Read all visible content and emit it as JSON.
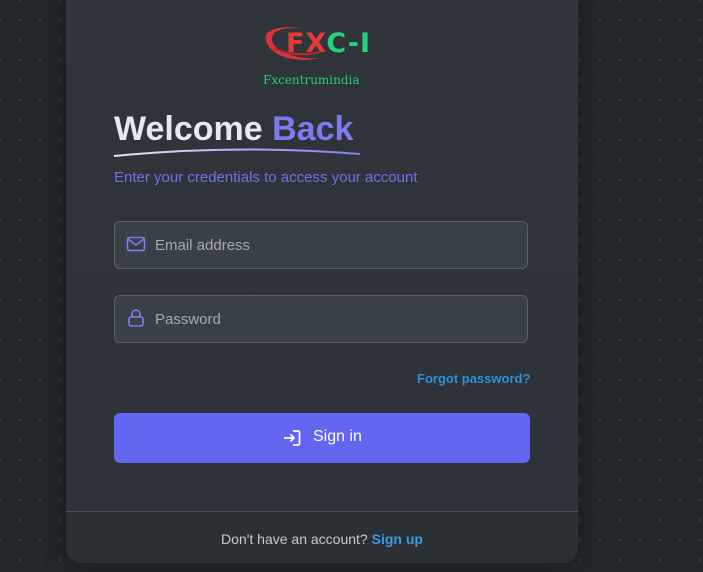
{
  "logo": {
    "mark_text_fx": "FX",
    "mark_text_rest": "C-I",
    "subtitle": "Fxcentrumindia"
  },
  "heading": {
    "part1": "Welcome ",
    "part2": "Back"
  },
  "subtitle": "Enter your credentials to access your account",
  "email": {
    "placeholder": "Email address",
    "value": "",
    "icon": "mail-icon"
  },
  "password": {
    "placeholder": "Password",
    "value": "",
    "icon": "lock-icon"
  },
  "forgot_label": "Forgot password?",
  "signin": {
    "label": "Sign in",
    "icon": "login-icon"
  },
  "footer": {
    "prompt": "Don't have an account? ",
    "signup_label": "Sign up"
  },
  "colors": {
    "accent": "#6366f1",
    "link": "#2f8fd8",
    "logo_green": "#27d07e",
    "logo_red": "#e43a3a"
  }
}
